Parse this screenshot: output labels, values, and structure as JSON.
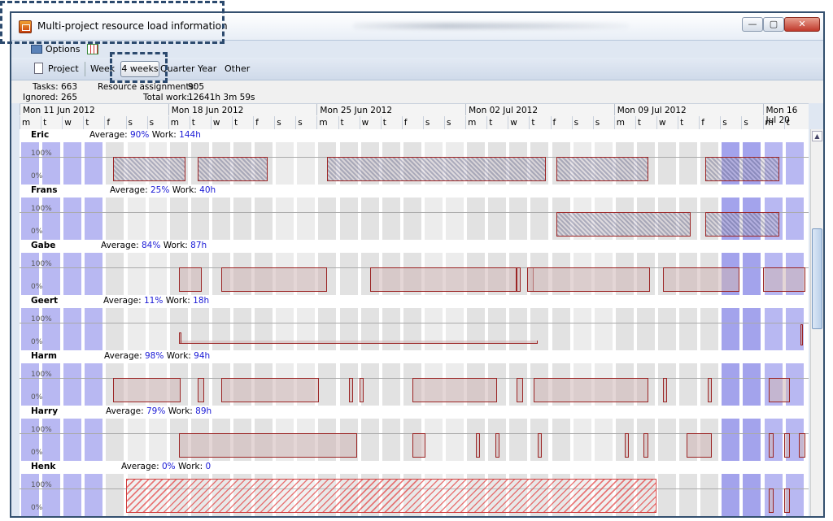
{
  "window": {
    "title": "Multi-project resource load information",
    "buttons": {
      "minimize": "—",
      "maximize": "▢",
      "close": "✕"
    }
  },
  "toolbar1": {
    "options_label": "Options"
  },
  "toolbar2": {
    "project": "Project",
    "week": "Week",
    "four_weeks": "4 weeks",
    "quarter": "Quarter",
    "year": "Year",
    "other": "Other"
  },
  "info": {
    "tasks_label": "Tasks:",
    "tasks_value": "663",
    "ignored_label": "Ignored:",
    "ignored_value": "265",
    "assignments_label": "Resource assignments:",
    "assignments_value": "905",
    "total_work_label": "Total work:",
    "total_work_value": "12641h 3m 59s"
  },
  "timeline": {
    "weeks": [
      "Mon 11 Jun 2012",
      "Mon 18 Jun 2012",
      "Mon 25 Jun 2012",
      "Mon 02 Jul 2012",
      "Mon 09 Jul 2012",
      "Mon 16 Jul 20"
    ],
    "days": [
      "m",
      "t",
      "w",
      "t",
      "f",
      "s",
      "s",
      "m",
      "t",
      "w",
      "t",
      "f",
      "s",
      "s",
      "m",
      "t",
      "w",
      "t",
      "f",
      "s",
      "s",
      "m",
      "t",
      "w",
      "t",
      "f",
      "s",
      "s",
      "m",
      "t",
      "w",
      "t",
      "f",
      "s",
      "s",
      "m",
      "t"
    ]
  },
  "axis": {
    "top": "100%",
    "bottom": "0%"
  },
  "resources": [
    {
      "name": "Eric",
      "avg_label": "Average:",
      "avg": "90%",
      "work_label": "Work:",
      "work": "144h"
    },
    {
      "name": "Frans",
      "avg_label": "Average:",
      "avg": "25%",
      "work_label": "Work:",
      "work": "40h"
    },
    {
      "name": "Gabe",
      "avg_label": "Average:",
      "avg": "84%",
      "work_label": "Work:",
      "work": "87h"
    },
    {
      "name": "Geert",
      "avg_label": "Average:",
      "avg": "11%",
      "work_label": "Work:",
      "work": "18h"
    },
    {
      "name": "Harm",
      "avg_label": "Average:",
      "avg": "98%",
      "work_label": "Work:",
      "work": "94h"
    },
    {
      "name": "Harry",
      "avg_label": "Average:",
      "avg": "79%",
      "work_label": "Work:",
      "work": "89h"
    },
    {
      "name": "Henk",
      "avg_label": "Average:",
      "avg": "0%",
      "work_label": "Work:",
      "work": "0"
    }
  ],
  "colors": {
    "bar_border": "#9b2525",
    "selection": "#b8b8f2",
    "value_blue": "#1a1ad6"
  }
}
